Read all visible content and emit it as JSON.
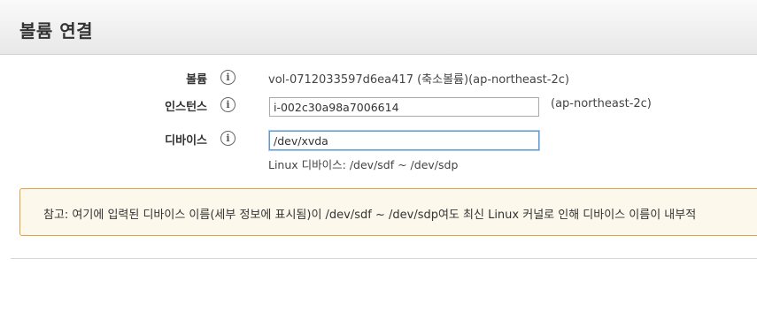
{
  "header": {
    "title": "볼륨 연결"
  },
  "form": {
    "volume": {
      "label": "볼륨",
      "info_icon": "info-icon",
      "value": "vol-0712033597d6ea417 (축소볼륨)(ap-northeast-2c)"
    },
    "instance": {
      "label": "인스턴스",
      "info_icon": "info-icon",
      "value": "i-002c30a98a7006614",
      "az": "(ap-northeast-2c)"
    },
    "device": {
      "label": "디바이스",
      "info_icon": "info-icon",
      "value": "/dev/xvda",
      "hint": "Linux 디바이스: /dev/sdf ~ /dev/sdp"
    }
  },
  "note": {
    "text": "참고: 여기에 입력된 디바이스 이름(세부 정보에 표시됨)이 /dev/sdf ~ /dev/sdp여도 최신 Linux 커널로 인해 디바이스 이름이 내부적"
  },
  "colors": {
    "note_background": "#fdf8ec",
    "note_border": "#e5a042",
    "focus_border": "#5b9bd5"
  }
}
